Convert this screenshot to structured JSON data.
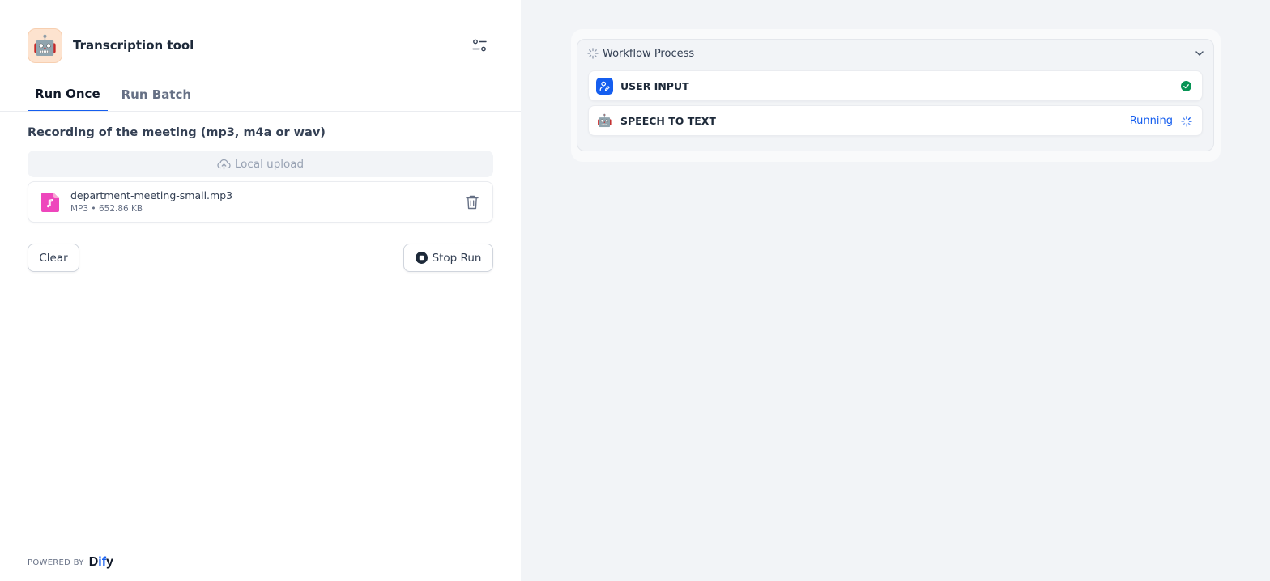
{
  "app": {
    "title": "Transcription tool",
    "avatar_emoji": "🤖"
  },
  "tabs": [
    {
      "label": "Run Once",
      "active": true
    },
    {
      "label": "Run Batch",
      "active": false
    }
  ],
  "form": {
    "field_label": "Recording of the meeting (mp3, m4a or wav)",
    "upload_label": "Local upload",
    "file": {
      "name": "department-meeting-small.mp3",
      "type": "MP3",
      "separator": "•",
      "size": "652.86 KB"
    },
    "clear_label": "Clear",
    "stop_label": "Stop Run"
  },
  "footer": {
    "powered_by": "POWERED BY",
    "logo_part1": "D",
    "logo_part2": "i",
    "logo_part3": "f",
    "logo_part4": "y"
  },
  "workflow": {
    "title": "Workflow Process",
    "nodes": [
      {
        "title": "USER INPUT",
        "status": "succeeded"
      },
      {
        "title": "SPEECH TO TEXT",
        "status_text": "Running",
        "icon_emoji": "🤖"
      }
    ]
  },
  "colors": {
    "accent": "#155eef",
    "success": "#079455",
    "file_icon": "#ee46bc",
    "avatar_bg": "#fde3cf"
  }
}
